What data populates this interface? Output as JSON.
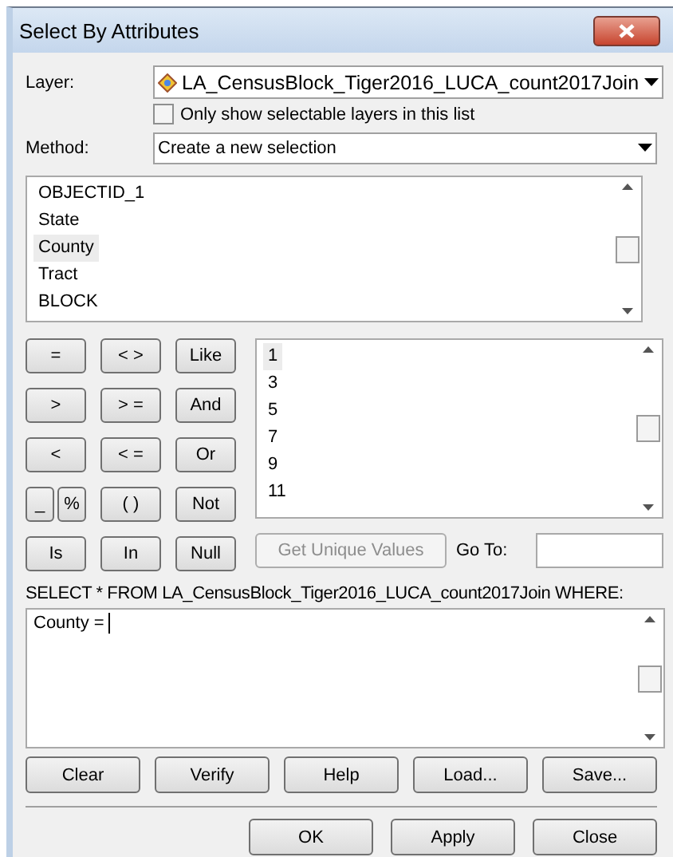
{
  "window": {
    "title": "Select By Attributes"
  },
  "layer": {
    "label": "Layer:",
    "value": "LA_CensusBlock_Tiger2016_LUCA_count2017Join"
  },
  "selectable_only": {
    "label": "Only show selectable layers in this list",
    "checked": false
  },
  "method": {
    "label": "Method:",
    "value": "Create a new selection"
  },
  "fields": [
    {
      "label": "OBJECTID_1",
      "selected": false
    },
    {
      "label": "State",
      "selected": false
    },
    {
      "label": "County",
      "selected": true
    },
    {
      "label": "Tract",
      "selected": false
    },
    {
      "label": "BLOCK",
      "selected": false
    }
  ],
  "operator_rows": [
    [
      {
        "label": "=",
        "kind": "full"
      },
      {
        "label": "< >",
        "kind": "full"
      },
      {
        "label": "Like",
        "kind": "full"
      }
    ],
    [
      {
        "label": ">",
        "kind": "full"
      },
      {
        "label": "> =",
        "kind": "full"
      },
      {
        "label": "And",
        "kind": "full"
      }
    ],
    [
      {
        "label": "<",
        "kind": "full"
      },
      {
        "label": "< =",
        "kind": "full"
      },
      {
        "label": "Or",
        "kind": "full"
      }
    ],
    [
      {
        "label": "_",
        "kind": "half"
      },
      {
        "label": "%",
        "kind": "half"
      },
      {
        "label": "( )",
        "kind": "full"
      },
      {
        "label": "Not",
        "kind": "full"
      }
    ],
    [
      {
        "label": "Is",
        "kind": "full"
      },
      {
        "label": "In",
        "kind": "full"
      },
      {
        "label": "Null",
        "kind": "full"
      }
    ]
  ],
  "values": [
    {
      "label": "1",
      "selected": true
    },
    {
      "label": "3",
      "selected": false
    },
    {
      "label": "5",
      "selected": false
    },
    {
      "label": "7",
      "selected": false
    },
    {
      "label": "9",
      "selected": false
    },
    {
      "label": "11",
      "selected": false
    }
  ],
  "unique_values_button": {
    "label": "Get Unique Values",
    "disabled": true
  },
  "goto": {
    "label": "Go To:"
  },
  "sql_label": "SELECT * FROM LA_CensusBlock_Tiger2016_LUCA_count2017Join WHERE:",
  "expression": "County = ",
  "expression_buttons": [
    "Clear",
    "Verify",
    "Help",
    "Load...",
    "Save..."
  ],
  "dialog_buttons": [
    "OK",
    "Apply",
    "Close"
  ]
}
